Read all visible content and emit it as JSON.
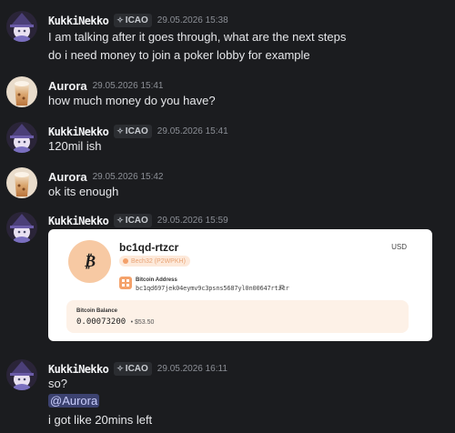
{
  "messages": [
    {
      "author": "KukkiNekko",
      "tag": "ICAO",
      "timestamp": "29.05.2026 15:38",
      "lines": [
        "I am talking after it goes through, what are the next steps",
        "do i need money to join a poker lobby for example"
      ]
    },
    {
      "author": "Aurora",
      "timestamp": "29.05.2026 15:41",
      "lines": [
        "how much money do you have?"
      ]
    },
    {
      "author": "KukkiNekko",
      "tag": "ICAO",
      "timestamp": "29.05.2026 15:41",
      "lines": [
        "120mil ish"
      ]
    },
    {
      "author": "Aurora",
      "timestamp": "29.05.2026 15:42",
      "lines": [
        "ok its enough"
      ]
    },
    {
      "author": "KukkiNekko",
      "tag": "ICAO",
      "timestamp": "29.05.2026 15:59",
      "embed": {
        "coin_symbol": "₿",
        "address_short": "bc1qd-rtzcr",
        "currency": "USD",
        "address_type": "Bech32 (P2WPKH)",
        "address_label": "Bitcoin Address",
        "address_full": "bc1qd697jek04eymv9c3psns5687yl0n00647rtzcr",
        "balance_label": "Bitcoin Balance",
        "balance_btc": "0.00073200",
        "balance_usd": "• $53.50"
      }
    },
    {
      "author": "KukkiNekko",
      "tag": "ICAO",
      "timestamp": "29.05.2026 16:11",
      "lines": [
        "so?",
        "@Aurora",
        "i got like 20mins left"
      ]
    }
  ],
  "colors": {
    "background": "#1b1c1f",
    "mention_bg": "#3c4270",
    "mention_text": "#c9cdfb",
    "coin_bg": "#f7c9a3",
    "accent_orange": "#f4a26b"
  },
  "icons": {
    "tag_icon": "sparkle-icon",
    "copy_icon": "copy-icon",
    "qr_icon": "qr-code-icon",
    "coin_icon": "bitcoin-icon"
  }
}
